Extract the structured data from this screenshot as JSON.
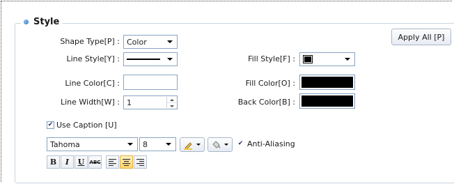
{
  "section_title": "Style",
  "labels": {
    "shape_type": "Shape Type[P] :",
    "line_style": "Line Style[Y] :",
    "line_color": "Line Color[C] :",
    "line_width": "Line Width[W] :",
    "fill_style": "Fill Style[F] :",
    "fill_color": "Fill Color[O] :",
    "back_color": "Back Color[B] :"
  },
  "values": {
    "shape_type": "Color",
    "line_width": "1",
    "font_name": "Tahoma",
    "font_size": "8"
  },
  "buttons": {
    "apply_all": "Apply All [P]"
  },
  "checkboxes": {
    "use_caption": {
      "label": "Use Caption [U]",
      "checked": true
    },
    "anti_aliasing": {
      "label": "Anti-Aliasing",
      "checked": true
    }
  },
  "format_toolbar": {
    "bold": "B",
    "italic": "I",
    "underline": "U",
    "strikeout": "ABC"
  },
  "colors": {
    "line_color": "#ffffff",
    "fill_color": "#000000",
    "back_color": "#000000",
    "accent": "#1f6fbf"
  }
}
